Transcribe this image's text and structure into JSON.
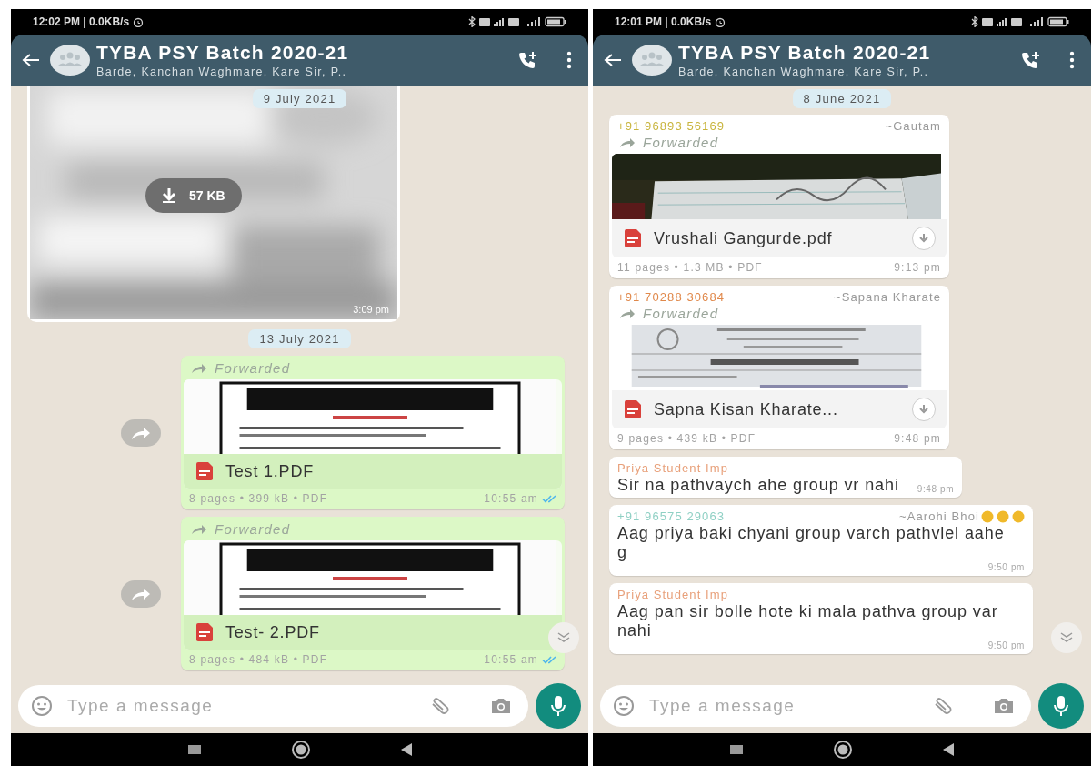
{
  "phones": [
    {
      "status_bar": {
        "text": "12:02 PM | 0.0KB/s"
      },
      "header": {
        "title": "TYBA PSY Batch 2020-21",
        "subtitle": "Barde, Kanchan Waghmare, Kare Sir, P.."
      },
      "sticky_date": "9 July 2021",
      "scroll_down_button": true,
      "messages": [
        {
          "outgoing": false,
          "download_size": "57 KB",
          "time": "3:09 pm"
        },
        {
          "kind": "date",
          "text": "13 July 2021"
        },
        {
          "kind": "document",
          "outgoing": true,
          "share_button": true,
          "forwarded_label": "Forwarded",
          "file_name": "Test 1.PDF",
          "downloaded": true,
          "meta": "8 pages • 399 kB • PDF",
          "time": "10:55 am",
          "read": true
        },
        {
          "kind": "document",
          "outgoing": true,
          "share_button": true,
          "forwarded_label": "Forwarded",
          "file_name": "Test- 2.PDF",
          "downloaded": true,
          "meta": "8 pages • 484 kB • PDF",
          "time": "10:55 am",
          "read": true
        }
      ],
      "composer": {
        "placeholder": "Type a message"
      }
    },
    {
      "status_bar": {
        "text": "12:01 PM | 0.0KB/s"
      },
      "header": {
        "title": "TYBA PSY Batch 2020-21",
        "subtitle": "Barde, Kanchan Waghmare, Kare Sir, P.."
      },
      "sticky_date": "8 June 2021",
      "scroll_down_button": true,
      "messages": [
        {
          "kind": "document",
          "outgoing": false,
          "sender": "+91 96893 56169",
          "color": "#c8b43c",
          "alias": "~Gautam",
          "forwarded_label": "Forwarded",
          "file_name": "Vrushali Gangurde.pdf",
          "downloaded": false,
          "meta": "11 pages • 1.3 MB • PDF",
          "time": "9:13 pm"
        },
        {
          "kind": "document",
          "outgoing": false,
          "sender": "+91 70288 30684",
          "color": "#e0884a",
          "alias": "~Sapana Kharate",
          "forwarded_label": "Forwarded",
          "file_name": "Sapna Kisan Kharate...",
          "downloaded": false,
          "meta": "9 pages • 439 kB • PDF",
          "time": "9:48 pm"
        },
        {
          "kind": "text",
          "outgoing": false,
          "sender": "Priya Student Imp",
          "color": "#e8a07a",
          "text": "Sir na pathvaych ahe group vr nahi",
          "time": "9:48 pm"
        },
        {
          "kind": "text",
          "outgoing": false,
          "sender": "+91 96575 29063",
          "color": "#8fd0c4",
          "alias": "~Aarohi Bhoi",
          "alias_emoji": true,
          "text": "Aag priya baki chyani group varch pathvlel aahe g",
          "time": "9:50 pm"
        },
        {
          "kind": "text",
          "outgoing": false,
          "sender": "Priya Student Imp",
          "color": "#e8a07a",
          "text": "Aag pan sir bolle hote ki mala pathva group var nahi",
          "time": "9:50 pm"
        }
      ],
      "composer": {
        "placeholder": "Type a message"
      }
    }
  ]
}
